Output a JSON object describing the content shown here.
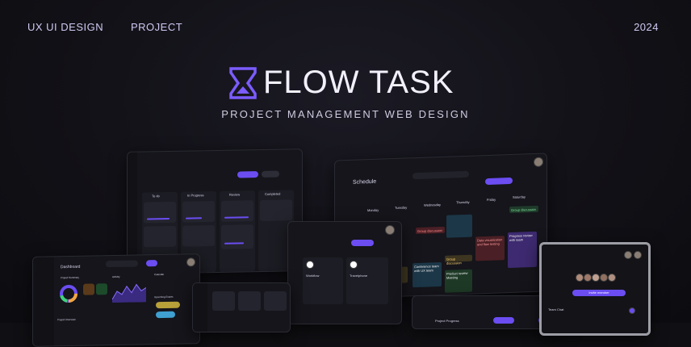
{
  "header": {
    "left1": "UX UI DESIGN",
    "left2": "PROJECT",
    "year": "2024"
  },
  "brand": {
    "name": "FLOW TASK",
    "tagline": "PROJECT MANAGEMENT WEB DESIGN",
    "accent": "#6b4df2"
  },
  "schedule": {
    "title": "Schedule",
    "days": [
      "Monday",
      "Tuesday",
      "Wednesday",
      "Thursday",
      "Friday",
      "Saturday"
    ],
    "events": [
      "Group discussion",
      "Group discussion",
      "Data visualization and flow testing",
      "Progress review with team",
      "Conference team with UX team",
      "Product review Meeting",
      "Group discussion",
      "Group discussion"
    ]
  },
  "dashboard": {
    "title": "Dashboard",
    "project_summary": "Project Summary",
    "activity": "Activity",
    "calendar": "Calendar",
    "project_overview": "Project Overview",
    "upcoming_events": "Upcoming Events"
  },
  "chat": {
    "invite_button": "Invite member",
    "team_chat": "Team Chat"
  },
  "kanban": {
    "columns": [
      "To do",
      "In Progress",
      "Review",
      "Completed"
    ]
  },
  "projects_panel": {
    "cards": [
      "Workflow",
      "Travelphone"
    ]
  },
  "progress_panel": {
    "title": "Project Progress"
  }
}
